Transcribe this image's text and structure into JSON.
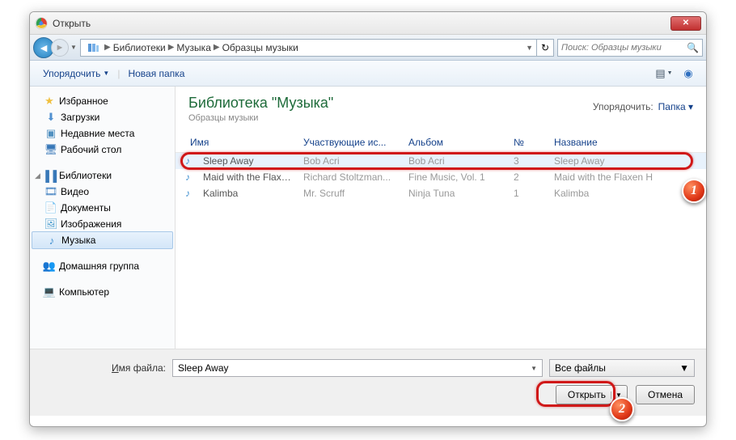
{
  "window": {
    "title": "Открыть"
  },
  "breadcrumb": {
    "p1": "Библиотеки",
    "p2": "Музыка",
    "p3": "Образцы музыки"
  },
  "search": {
    "placeholder": "Поиск: Образцы музыки"
  },
  "toolbar": {
    "organize": "Упорядочить",
    "newfolder": "Новая папка"
  },
  "sidebar": {
    "favorites": "Избранное",
    "downloads": "Загрузки",
    "recent": "Недавние места",
    "desktop": "Рабочий стол",
    "libraries": "Библиотеки",
    "video": "Видео",
    "documents": "Документы",
    "images": "Изображения",
    "music": "Музыка",
    "homegroup": "Домашняя группа",
    "computer": "Компьютер"
  },
  "libheader": {
    "title": "Библиотека \"Музыка\"",
    "subtitle": "Образцы музыки",
    "sort_label": "Упорядочить:",
    "sort_value": "Папка"
  },
  "columns": {
    "name": "Имя",
    "artist": "Участвующие ис...",
    "album": "Альбом",
    "num": "№",
    "title": "Название"
  },
  "files": [
    {
      "name": "Sleep Away",
      "artist": "Bob Acri",
      "album": "Bob Acri",
      "num": "3",
      "title": "Sleep Away"
    },
    {
      "name": "Maid with the Flaxe...",
      "artist": "Richard Stoltzman...",
      "album": "Fine Music, Vol. 1",
      "num": "2",
      "title": "Maid with the Flaxen H"
    },
    {
      "name": "Kalimba",
      "artist": "Mr. Scruff",
      "album": "Ninja Tuna",
      "num": "1",
      "title": "Kalimba"
    }
  ],
  "bottom": {
    "filename_label_pre": "И",
    "filename_label_post": "мя файла:",
    "filename_value": "Sleep Away",
    "filetype": "Все файлы",
    "open": "Открыть",
    "cancel": "Отмена"
  },
  "badges": {
    "b1": "1",
    "b2": "2"
  }
}
